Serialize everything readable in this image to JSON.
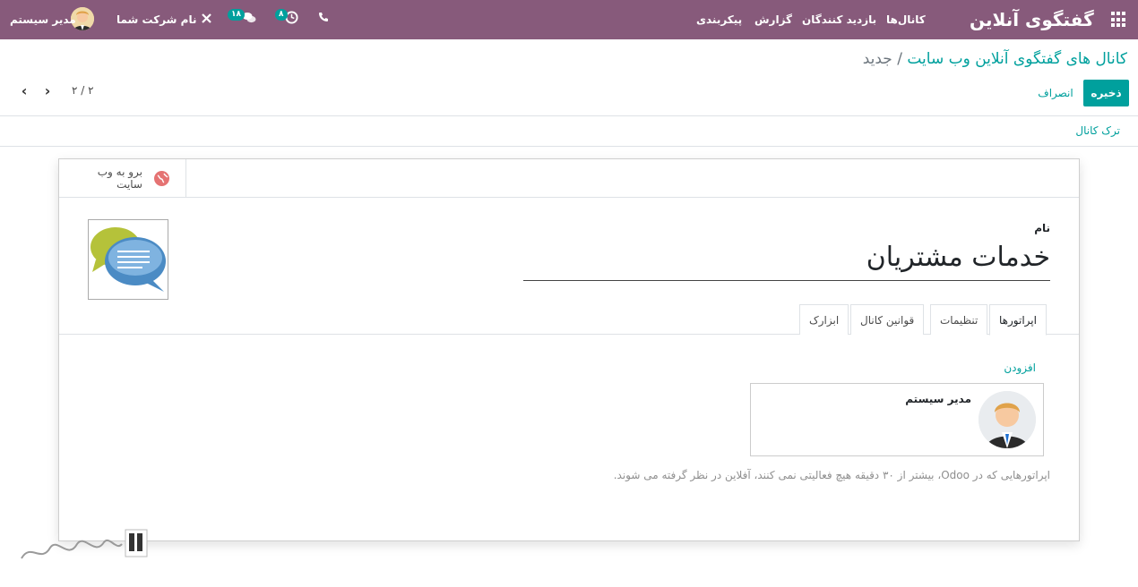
{
  "navbar": {
    "app_title": "گفتگوی آنلاین",
    "menu": [
      "کانال‌ها",
      "بازدید کنندگان",
      "گزارش",
      "پیکربندی"
    ],
    "activity_badge": "۸",
    "messages_badge": "۱۸",
    "company": "نام شرکت شما",
    "user": "مدیر سیستم",
    "colors": {
      "bar": "#875a7b",
      "accent": "#00a09d"
    }
  },
  "control_panel": {
    "breadcrumb_link": "کانال های گفتگوی آنلاین وب سایت",
    "breadcrumb_sep": "/",
    "breadcrumb_current": "جدید",
    "save_label": "ذخیره",
    "discard_label": "انصراف",
    "pager": "۲ / ۲"
  },
  "statusbar": {
    "leave_channel": "ترک کانال"
  },
  "form": {
    "goto_website": "برو به وب سایت",
    "name_label": "نام",
    "name_value": "خدمات مشتریان",
    "tabs": [
      "اپراتورها",
      "تنظیمات",
      "قوانین کانال",
      "ابزارک"
    ],
    "add_label": "افزودن",
    "operator_name": "مدیر سیستم",
    "hint": "اپراتورهایی که در Odoo، بیشتر از ۳۰ دقیقه هیچ فعالیتی نمی کنند، آفلاین در نظر گرفته می شوند."
  }
}
